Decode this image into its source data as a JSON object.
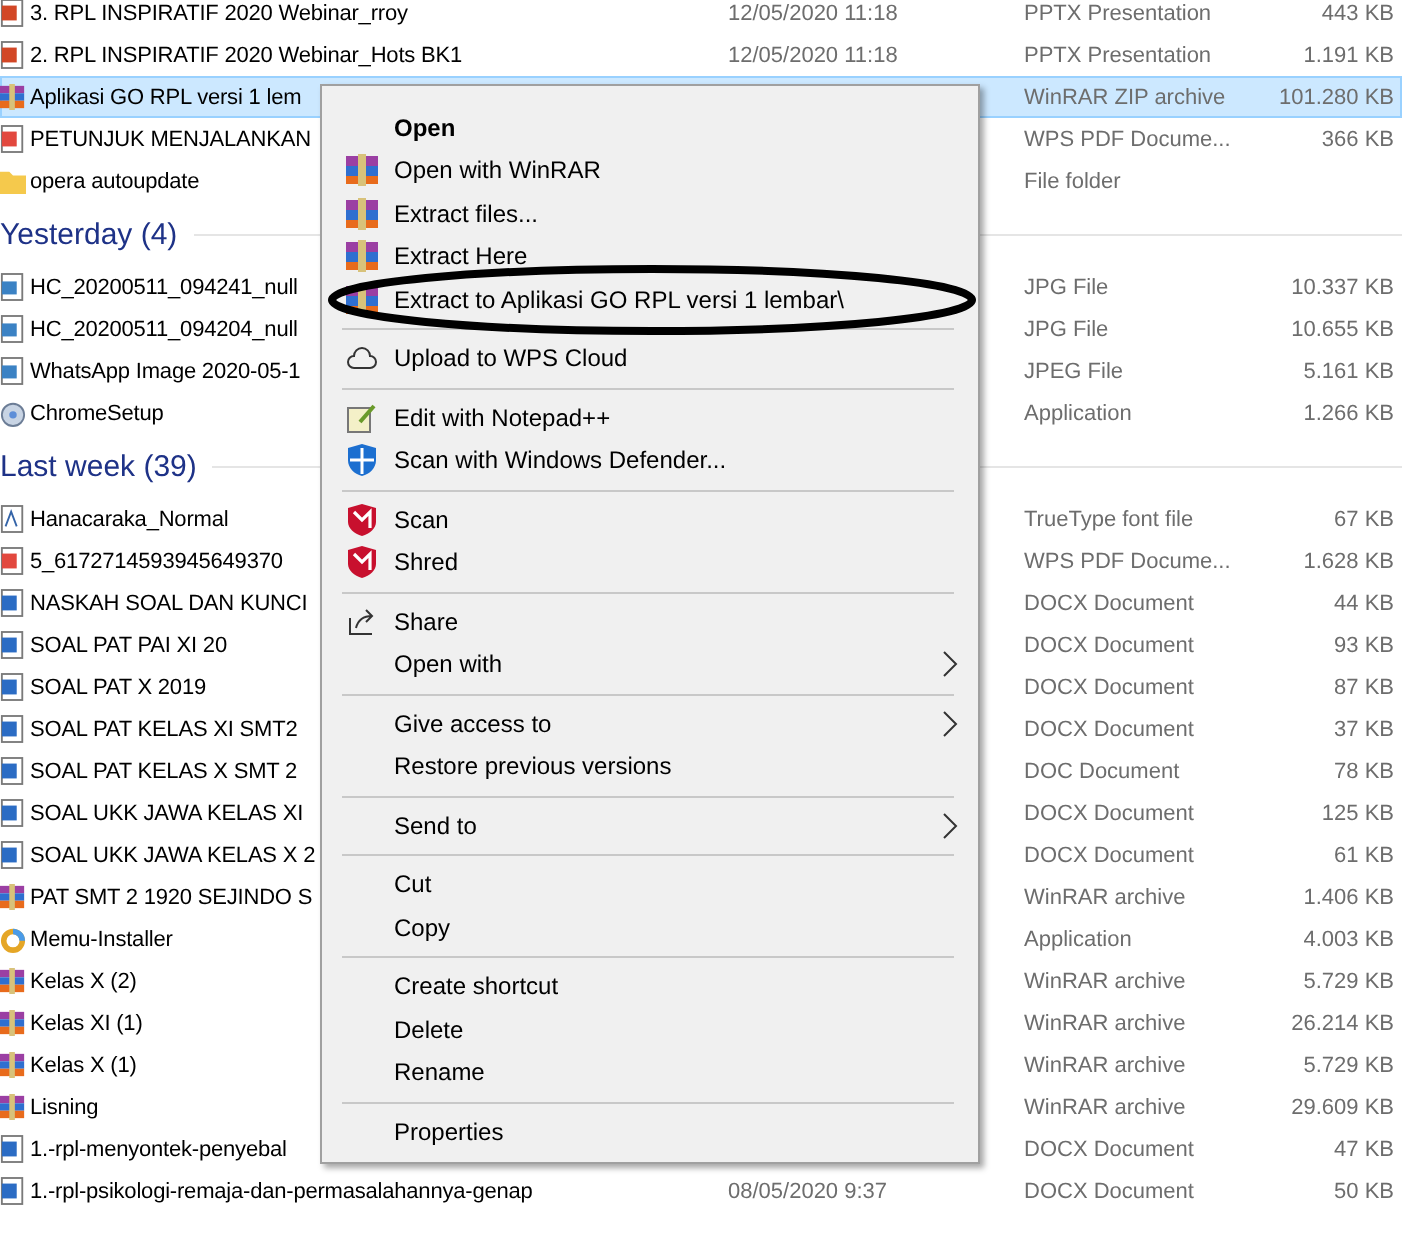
{
  "groups": [
    {
      "rows": [
        {
          "kind": "pptx",
          "name": "3. RPL INSPIRATIF 2020 Webinar_rroy",
          "date": "12/05/2020 11:18",
          "type": "PPTX Presentation",
          "size": "443 KB",
          "selected": false
        },
        {
          "kind": "pptx",
          "name": "2. RPL INSPIRATIF 2020 Webinar_Hots BK1",
          "date": "12/05/2020 11:18",
          "type": "PPTX Presentation",
          "size": "1.191 KB",
          "selected": false
        },
        {
          "kind": "archive",
          "name": "Aplikasi GO RPL versi 1 lem",
          "type": "WinRAR ZIP archive",
          "size": "101.280 KB",
          "selected": true
        },
        {
          "kind": "pdf",
          "name": "PETUNJUK MENJALANKAN",
          "type": "WPS PDF Docume...",
          "size": "366 KB",
          "selected": false
        },
        {
          "kind": "folder",
          "name": "opera autoupdate",
          "type": "File folder",
          "selected": false
        }
      ]
    },
    {
      "header": "Yesterday (4)",
      "rows": [
        {
          "kind": "image",
          "name": "HC_20200511_094241_null",
          "type": "JPG File",
          "size": "10.337 KB",
          "selected": false
        },
        {
          "kind": "image",
          "name": "HC_20200511_094204_null",
          "type": "JPG File",
          "size": "10.655 KB",
          "selected": false
        },
        {
          "kind": "image",
          "name": "WhatsApp Image 2020-05-1",
          "type": "JPEG File",
          "size": "5.161 KB",
          "selected": false
        },
        {
          "kind": "app",
          "name": "ChromeSetup",
          "type": "Application",
          "size": "1.266 KB",
          "selected": false
        }
      ]
    },
    {
      "header": "Last week (39)",
      "rows": [
        {
          "kind": "font",
          "name": "Hanacaraka_Normal",
          "type": "TrueType font file",
          "size": "67 KB",
          "selected": false
        },
        {
          "kind": "pdf",
          "name": "5_6172714593945649370",
          "type": "WPS PDF Docume...",
          "size": "1.628 KB",
          "selected": false
        },
        {
          "kind": "docx",
          "name": "NASKAH SOAL DAN KUNCI",
          "type": "DOCX Document",
          "size": "44 KB",
          "selected": false
        },
        {
          "kind": "docx",
          "name": "SOAL PAT PAI XI 20",
          "type": "DOCX Document",
          "size": "93 KB",
          "selected": false
        },
        {
          "kind": "docx",
          "name": "SOAL PAT   X 2019",
          "type": "DOCX Document",
          "size": "87 KB",
          "selected": false
        },
        {
          "kind": "docx",
          "name": "SOAL PAT KELAS XI SMT2",
          "type": "DOCX Document",
          "size": "37 KB",
          "selected": false
        },
        {
          "kind": "docx",
          "name": "SOAL PAT KELAS X SMT 2",
          "type": "DOC Document",
          "size": "78 KB",
          "selected": false
        },
        {
          "kind": "docx",
          "name": "SOAL UKK JAWA KELAS XI",
          "type": "DOCX Document",
          "size": "125 KB",
          "selected": false
        },
        {
          "kind": "docx",
          "name": "SOAL UKK JAWA KELAS X 2",
          "type": "DOCX Document",
          "size": "61 KB",
          "selected": false
        },
        {
          "kind": "archive",
          "name": "PAT SMT 2 1920 SEJINDO S",
          "type": "WinRAR archive",
          "size": "1.406 KB",
          "selected": false
        },
        {
          "kind": "installer",
          "name": "Memu-Installer",
          "type": "Application",
          "size": "4.003 KB",
          "selected": false
        },
        {
          "kind": "archive",
          "name": "Kelas X (2)",
          "type": "WinRAR archive",
          "size": "5.729 KB",
          "selected": false
        },
        {
          "kind": "archive",
          "name": "Kelas XI (1)",
          "type": "WinRAR archive",
          "size": "26.214 KB",
          "selected": false
        },
        {
          "kind": "archive",
          "name": "Kelas X (1)",
          "type": "WinRAR archive",
          "size": "5.729 KB",
          "selected": false
        },
        {
          "kind": "archive",
          "name": "Lisning",
          "type": "WinRAR archive",
          "size": "29.609 KB",
          "selected": false
        },
        {
          "kind": "docx",
          "name": "1.-rpl-menyontek-penyebal",
          "type": "DOCX Document",
          "size": "47 KB",
          "selected": false
        },
        {
          "kind": "docx",
          "name": "1.-rpl-psikologi-remaja-dan-permasalahannya-genap",
          "date": "08/05/2020 9:37",
          "type": "DOCX Document",
          "size": "50 KB",
          "selected": false
        }
      ]
    }
  ],
  "context_menu": [
    {
      "kind": "plain",
      "label": "Open",
      "default": true
    },
    {
      "kind": "winrar",
      "label": "Open with WinRAR"
    },
    {
      "kind": "winrar",
      "label": "Extract files..."
    },
    {
      "kind": "winrar",
      "label": "Extract Here"
    },
    {
      "kind": "winrar",
      "label": "Extract to Aplikasi GO RPL versi 1 lembar\\",
      "circled": true
    },
    {
      "kind": "separator"
    },
    {
      "kind": "cloud",
      "label": "Upload to WPS Cloud"
    },
    {
      "kind": "separator"
    },
    {
      "kind": "notepad",
      "label": "Edit with Notepad++"
    },
    {
      "kind": "defender",
      "label": "Scan with Windows Defender..."
    },
    {
      "kind": "separator"
    },
    {
      "kind": "shield",
      "label": "Scan"
    },
    {
      "kind": "shield",
      "label": "Shred"
    },
    {
      "kind": "separator"
    },
    {
      "kind": "share",
      "label": "Share"
    },
    {
      "kind": "plain",
      "label": "Open with",
      "submenu": true
    },
    {
      "kind": "separator"
    },
    {
      "kind": "plain",
      "label": "Give access to",
      "submenu": true
    },
    {
      "kind": "plain",
      "label": "Restore previous versions"
    },
    {
      "kind": "separator"
    },
    {
      "kind": "plain",
      "label": "Send to",
      "submenu": true
    },
    {
      "kind": "separator"
    },
    {
      "kind": "plain",
      "label": "Cut"
    },
    {
      "kind": "plain",
      "label": "Copy"
    },
    {
      "kind": "separator"
    },
    {
      "kind": "plain",
      "label": "Create shortcut"
    },
    {
      "kind": "plain",
      "label": "Delete"
    },
    {
      "kind": "plain",
      "label": "Rename"
    },
    {
      "kind": "separator"
    },
    {
      "kind": "plain",
      "label": "Properties"
    }
  ]
}
